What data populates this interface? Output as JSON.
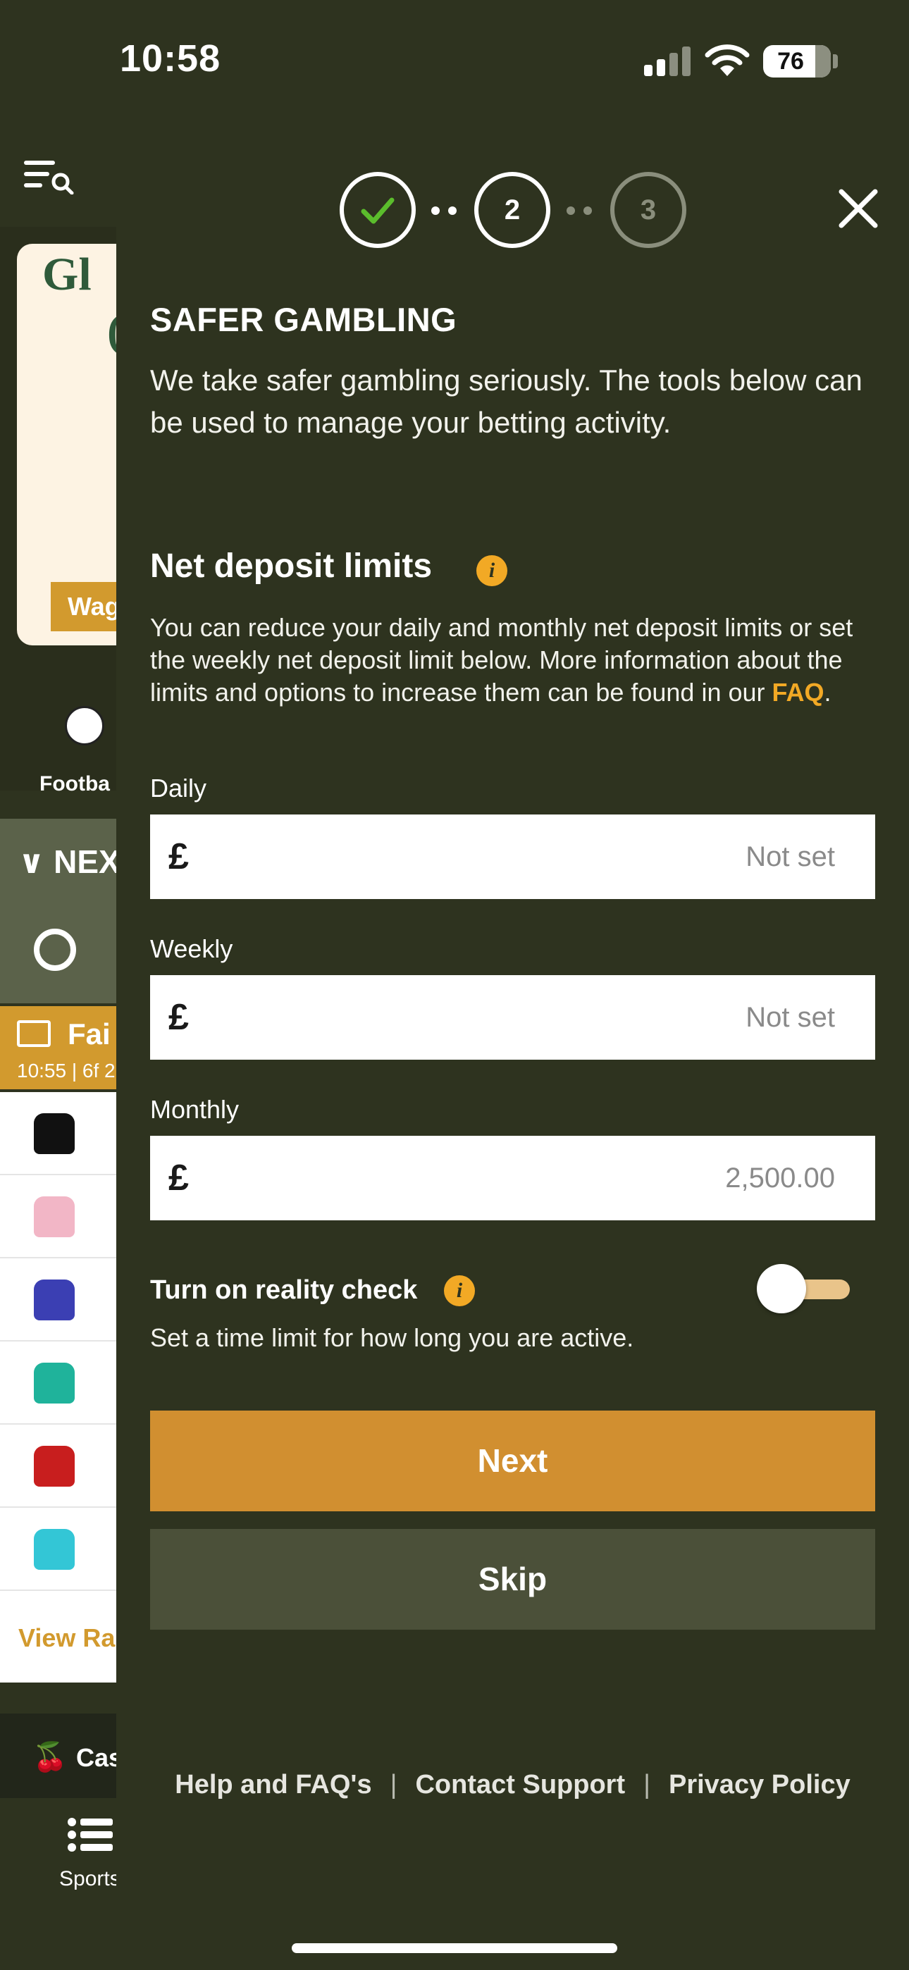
{
  "status_bar": {
    "time": "10:58",
    "battery": "76"
  },
  "background_page": {
    "banner_text_1": "Gl",
    "banner_text_2": "(",
    "banner_button": "Wag",
    "sport_label": "Footba",
    "next_label": "NEX",
    "race_title": "Fai",
    "race_time": "10:55 | 6f 2",
    "view_link": "View Ra",
    "casino_label": "Cas",
    "sports_tab_label": "Sports",
    "silk_colors": [
      "#111111",
      "#f2b6c6",
      "#3b3fb3",
      "#1fb39b",
      "#c81e1e",
      "#33c6d6"
    ]
  },
  "stepper": {
    "step1": "✓",
    "step2": "2",
    "step3": "3"
  },
  "modal": {
    "heading": "SAFER GAMBLING",
    "intro": "We take safer gambling seriously. The tools below can be used to manage your betting activity.",
    "limits_title": "Net deposit limits",
    "limits_desc_before": "You can reduce your daily and monthly net deposit limits or set the weekly net deposit limit below. More information about the limits and options to increase them can be found in our ",
    "limits_desc_link": "FAQ",
    "limits_desc_after": ".",
    "currency_symbol": "£",
    "fields": {
      "daily": {
        "label": "Daily",
        "placeholder": "Not set",
        "value": ""
      },
      "weekly": {
        "label": "Weekly",
        "placeholder": "Not set",
        "value": ""
      },
      "monthly": {
        "label": "Monthly",
        "placeholder": "",
        "value": "2,500.00"
      }
    },
    "reality_check": {
      "label": "Turn on reality check",
      "desc": "Set a time limit for how long you are active.",
      "enabled": false
    },
    "next_button": "Next",
    "skip_button": "Skip"
  },
  "footer": {
    "help": "Help and FAQ's",
    "contact": "Contact Support",
    "privacy": "Privacy Policy",
    "separator": "|"
  },
  "colors": {
    "background": "#2e331f",
    "accent": "#d18f30",
    "info": "#f2a925",
    "skip": "#4b5039"
  }
}
